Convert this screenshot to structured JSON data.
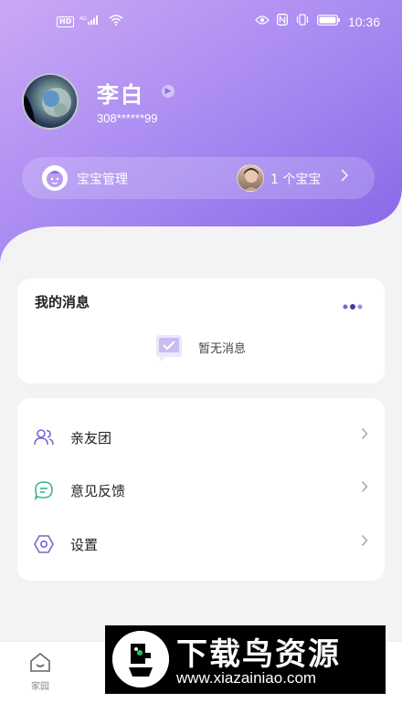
{
  "status_bar": {
    "hd": "HD",
    "signal_label": "4G",
    "time": "10:36"
  },
  "profile": {
    "name": "李白",
    "user_id": "308******99"
  },
  "baby_bar": {
    "label": "宝宝管理",
    "count": "1 个宝宝"
  },
  "messages": {
    "title": "我的消息",
    "empty_text": "暂无消息"
  },
  "menu": {
    "items": [
      {
        "label": "亲友团",
        "icon": "people-icon"
      },
      {
        "label": "意见反馈",
        "icon": "chat-icon"
      },
      {
        "label": "设置",
        "icon": "settings-icon"
      }
    ]
  },
  "bottom_nav": {
    "home_label": "家园"
  },
  "watermark": {
    "title": "下载鸟资源",
    "url": "www.xiazainiao.com"
  },
  "colors": {
    "header_start": "#c9a9f5",
    "header_end": "#8a6be8",
    "accent": "#7b63d6",
    "background": "#f3f3f6"
  }
}
